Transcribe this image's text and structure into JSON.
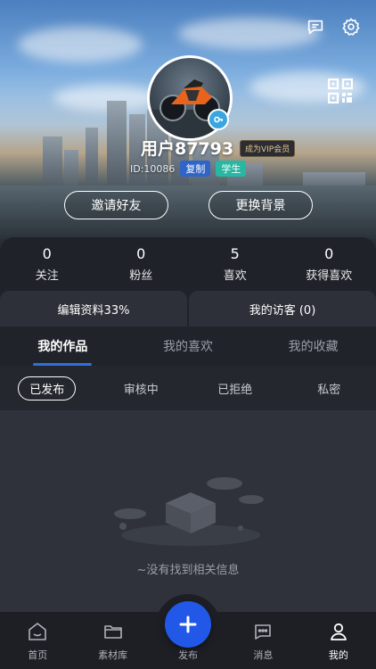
{
  "profile": {
    "username": "用户87793",
    "vip_label": "成为VIP会员",
    "id_text": "ID:10086",
    "copy_label": "复制",
    "role_tag": "学生",
    "invite_label": "邀请好友",
    "change_bg_label": "更换背景"
  },
  "stats": [
    {
      "num": "0",
      "label": "关注"
    },
    {
      "num": "0",
      "label": "粉丝"
    },
    {
      "num": "5",
      "label": "喜欢"
    },
    {
      "num": "0",
      "label": "获得喜欢"
    }
  ],
  "actions": {
    "edit_profile": "编辑资料33%",
    "visitors": "我的访客 (0)"
  },
  "tabs": [
    {
      "label": "我的作品"
    },
    {
      "label": "我的喜欢"
    },
    {
      "label": "我的收藏"
    }
  ],
  "filters": [
    {
      "label": "已发布"
    },
    {
      "label": "审核中"
    },
    {
      "label": "已拒绝"
    },
    {
      "label": "私密"
    }
  ],
  "empty_text": "~没有找到相关信息",
  "nav": [
    {
      "label": "首页",
      "icon": "home-icon"
    },
    {
      "label": "素材库",
      "icon": "folder-icon"
    },
    {
      "label": "发布",
      "icon": "plus-icon"
    },
    {
      "label": "消息",
      "icon": "message-icon"
    },
    {
      "label": "我的",
      "icon": "user-icon"
    }
  ],
  "colors": {
    "accent": "#2258e8",
    "tab_underline": "#2f6fe0",
    "copy_tag": "#2f64c9",
    "student_tag": "#27b7a3"
  }
}
